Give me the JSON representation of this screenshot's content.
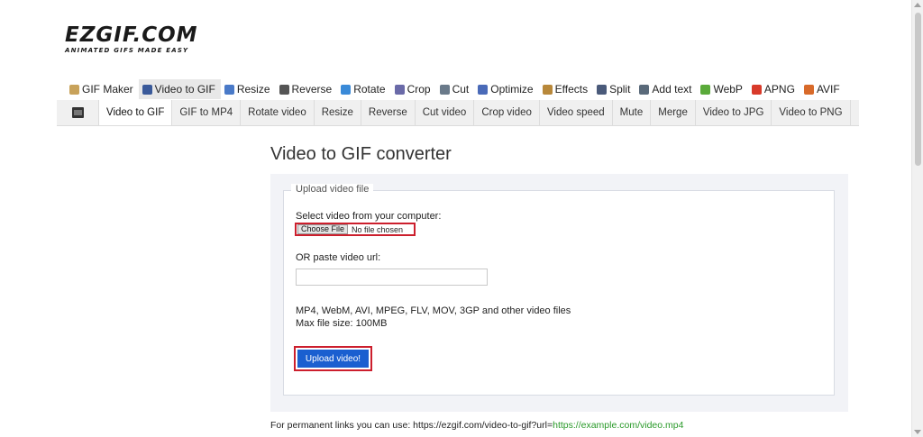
{
  "logo": {
    "main": "EZGIF.COM",
    "tagline": "ANIMATED GIFS MADE EASY"
  },
  "main_nav": [
    {
      "label": "GIF Maker",
      "icon": "gif-maker-icon",
      "color": "#c8a25a"
    },
    {
      "label": "Video to GIF",
      "icon": "video-to-gif-icon",
      "color": "#3a5a9a",
      "active": true
    },
    {
      "label": "Resize",
      "icon": "resize-icon",
      "color": "#4a7ac8"
    },
    {
      "label": "Reverse",
      "icon": "reverse-icon",
      "color": "#555555"
    },
    {
      "label": "Rotate",
      "icon": "rotate-icon",
      "color": "#3a8ad8"
    },
    {
      "label": "Crop",
      "icon": "crop-icon",
      "color": "#6a6aa8"
    },
    {
      "label": "Cut",
      "icon": "cut-icon",
      "color": "#6a7a8a"
    },
    {
      "label": "Optimize",
      "icon": "optimize-icon",
      "color": "#4a6ab8"
    },
    {
      "label": "Effects",
      "icon": "effects-icon",
      "color": "#b8883a"
    },
    {
      "label": "Split",
      "icon": "split-icon",
      "color": "#4a5a7a"
    },
    {
      "label": "Add text",
      "icon": "add-text-icon",
      "color": "#5a6a7a"
    },
    {
      "label": "WebP",
      "icon": "webp-icon",
      "color": "#5aaa3a"
    },
    {
      "label": "APNG",
      "icon": "apng-icon",
      "color": "#d83a2a"
    },
    {
      "label": "AVIF",
      "icon": "avif-icon",
      "color": "#d86a2a"
    }
  ],
  "sub_nav": [
    {
      "label": "Video to GIF",
      "active": true
    },
    {
      "label": "GIF to MP4"
    },
    {
      "label": "Rotate video"
    },
    {
      "label": "Resize"
    },
    {
      "label": "Reverse"
    },
    {
      "label": "Cut video"
    },
    {
      "label": "Crop video"
    },
    {
      "label": "Video speed"
    },
    {
      "label": "Mute"
    },
    {
      "label": "Merge"
    },
    {
      "label": "Video to JPG"
    },
    {
      "label": "Video to PNG"
    }
  ],
  "page_title": "Video to GIF converter",
  "upload": {
    "legend": "Upload video file",
    "select_label": "Select video from your computer:",
    "choose_button": "Choose File",
    "file_status": "No file chosen",
    "url_label": "OR paste video url:",
    "url_value": "",
    "formats_line1": "MP4, WebM, AVI, MPEG, FLV, MOV, 3GP and other video files",
    "formats_line2": "Max file size: 100MB",
    "upload_button": "Upload video!"
  },
  "permalink": {
    "prefix": "For permanent links you can use: https://ezgif.com/video-to-gif?url=",
    "example": "https://example.com/video.mp4"
  },
  "colors": {
    "highlight_border": "#cc1f2d",
    "upload_button_bg": "#1a5fd0",
    "link_green": "#2a9a2a"
  }
}
